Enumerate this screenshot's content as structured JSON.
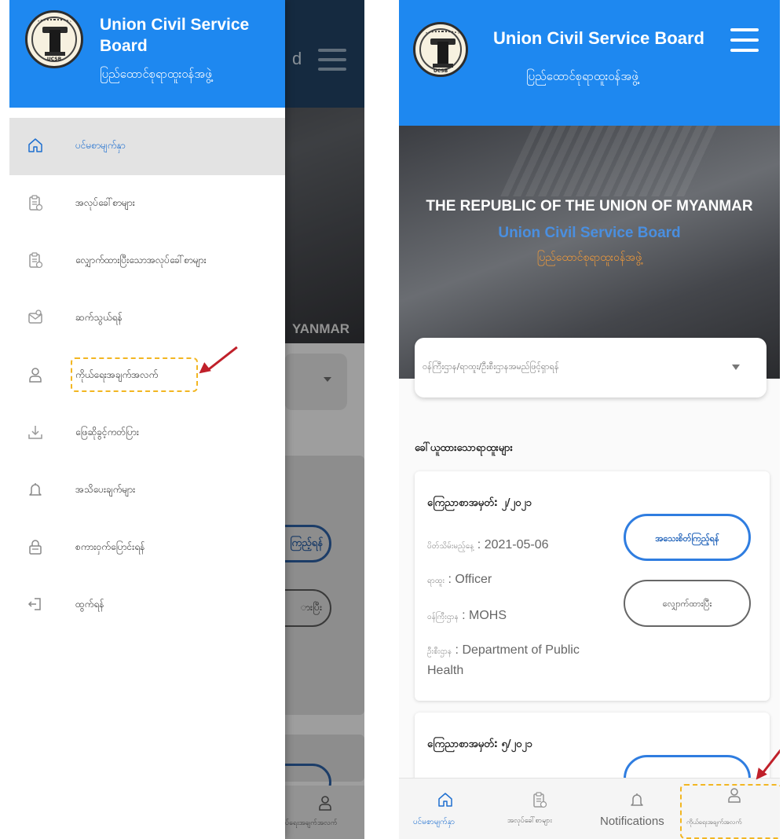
{
  "left_screen": {
    "header": {
      "title": "Union Civil Service Board",
      "subtitle": "ပြည်ထောင်စုရာထူးဝန်အဖွဲ့",
      "logo_text": "UCSB"
    },
    "menu_items": [
      {
        "label": "ပင်မစာမျက်နှာ",
        "icon": "home-icon",
        "active": true
      },
      {
        "label": "အလုပ်ခေါ်စာများ",
        "icon": "clipboard-icon",
        "active": false
      },
      {
        "label": "လျှောက်ထားပြီးသောအလုပ်ခေါ်စာများ",
        "icon": "clipboard-check-icon",
        "active": false
      },
      {
        "label": "ဆက်သွယ်ရန်",
        "icon": "contact-icon",
        "active": false
      },
      {
        "label": "ကိုယ်ရေးအချက်အလက်",
        "icon": "user-icon",
        "active": false
      },
      {
        "label": "ဖြေဆိုခွင့်ကတ်ပြား",
        "icon": "download-icon",
        "active": false
      },
      {
        "label": "အသိပေးချက်များ",
        "icon": "bell-icon",
        "active": false
      },
      {
        "label": "စကားဝှက်ပြောင်းရန်",
        "icon": "lock-icon",
        "active": false
      },
      {
        "label": "ထွက်ရန်",
        "icon": "logout-icon",
        "active": false
      }
    ],
    "background": {
      "header_title_fragment": "d",
      "hero_fragment": "YANMAR",
      "button1_fragment": "ကြည့်ရန်",
      "button2_fragment": "ားပြီး",
      "nav_label_fragment": "ပ်ရေးအချက်အလက်"
    }
  },
  "right_screen": {
    "header": {
      "title": "Union Civil Service Board",
      "subtitle": "ပြည်ထောင်စုရာထူးဝန်အဖွဲ့"
    },
    "hero": {
      "line1": "THE REPUBLIC OF THE UNION OF MYANMAR",
      "line2": "Union Civil Service Board",
      "line3": "ပြည်ထောင်စုရာထူးဝန်အဖွဲ့"
    },
    "search": {
      "placeholder": "ဝန်ကြီးဌာန/ရာထူး/ဦးစီးဌာနအမည်ဖြင့်ရှာရန်"
    },
    "section_title": "ခေါ်ယူထားသောရာထူးများ",
    "cards": [
      {
        "title": "ကြေညာစာအမှတ်: ၂/၂၀၂၁",
        "fields": [
          {
            "key": "ပိတ်သိမ်းမည့်နေ့",
            "value": "2021-05-06"
          },
          {
            "key": "ရာထူး",
            "value": "Officer"
          },
          {
            "key": "ဝန်ကြီးဌာန",
            "value": "MOHS"
          },
          {
            "key": "ဦးစီးဌာန",
            "value": "Department of Public Health"
          }
        ],
        "primary_button": "အသေးစိတ်ကြည့်ရန်",
        "secondary_button": "လျှောက်ထားပြီး"
      },
      {
        "title": "ကြေညာစာအမှတ်: ၅/၂၀၂၁"
      }
    ],
    "bottom_nav": [
      {
        "label": "ပင်မစာမျက်နှာ",
        "icon": "home-icon",
        "active": true
      },
      {
        "label": "အလုပ်ခေါ်စာများ",
        "icon": "clipboard-icon",
        "active": false
      },
      {
        "label": "Notifications",
        "icon": "bell-icon",
        "active": false
      },
      {
        "label": "ကိုယ်ရေးအချက်အလက်",
        "icon": "user-icon",
        "active": false
      }
    ]
  },
  "colors": {
    "brand_blue": "#1e88f0",
    "highlight_dash": "#f2b622",
    "arrow_red": "#c0202a"
  }
}
